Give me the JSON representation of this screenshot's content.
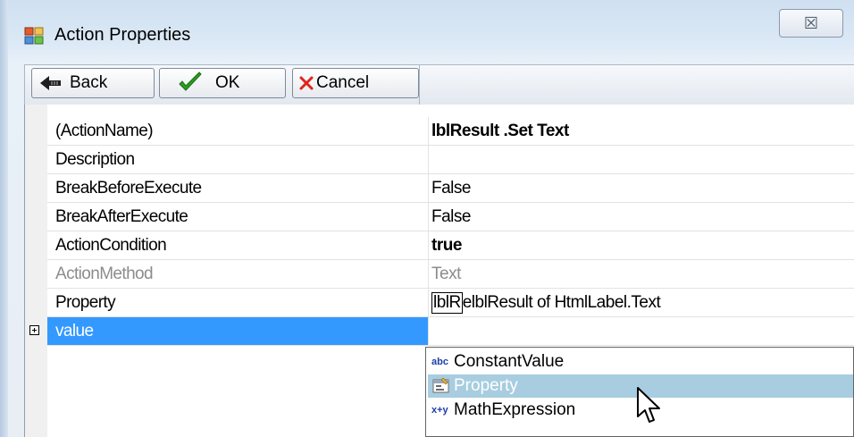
{
  "window": {
    "title": "Action Properties",
    "close_glyph": "☒"
  },
  "toolbar": {
    "back_label": "Back",
    "ok_label": "OK",
    "cancel_label": "Cancel"
  },
  "grid": {
    "rows": [
      {
        "name": "(ActionName)",
        "value": "lblResult .Set Text"
      },
      {
        "name": "Description",
        "value": ""
      },
      {
        "name": "BreakBeforeExecute",
        "value": "False"
      },
      {
        "name": "BreakAfterExecute",
        "value": "False"
      },
      {
        "name": "ActionCondition",
        "value": "true"
      },
      {
        "name": "ActionMethod",
        "value": "Text"
      },
      {
        "name": "Property",
        "value_box": "lblR",
        "value": "elblResult of HtmlLabel.Text"
      },
      {
        "name": "value",
        "value": ""
      }
    ]
  },
  "dropdown": {
    "items": [
      {
        "icon": "abc",
        "label": "ConstantValue"
      },
      {
        "icon": "property-icon",
        "label": "Property"
      },
      {
        "icon": "x+y",
        "label": "MathExpression"
      }
    ],
    "selected_index": 1
  },
  "colors": {
    "selection": "#3399ff",
    "hover_item": "#a8cde0",
    "frame": "#dce9f6"
  }
}
